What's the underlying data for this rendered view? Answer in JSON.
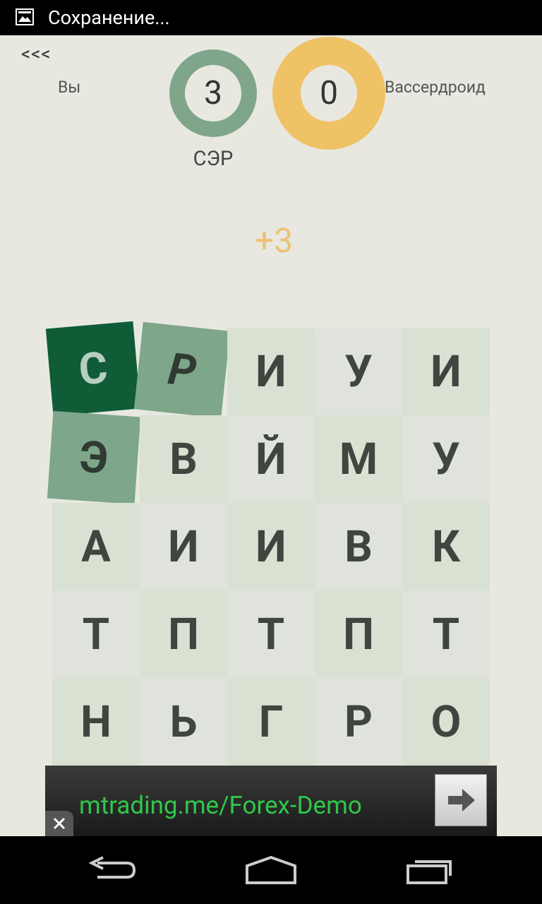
{
  "status": {
    "text": "Сохранение..."
  },
  "header": {
    "back_label": "<<<",
    "player_label": "Вы",
    "opponent_label": "Вассердроид",
    "player_score": "3",
    "opponent_score": "0",
    "current_word": "СЭР",
    "score_delta": "+3"
  },
  "grid": {
    "rows": [
      [
        "С",
        "Р",
        "И",
        "У",
        "И"
      ],
      [
        "Э",
        "В",
        "Й",
        "М",
        "У"
      ],
      [
        "А",
        "И",
        "И",
        "В",
        "К"
      ],
      [
        "Т",
        "П",
        "Т",
        "П",
        "Т"
      ],
      [
        "Н",
        "Ь",
        "Г",
        "Р",
        "О"
      ]
    ],
    "selected": [
      "r0c0",
      "r0c1",
      "r1c0"
    ]
  },
  "ad": {
    "text": "mtrading.me/Forex-Demo"
  },
  "colors": {
    "background": "#e8e8e1",
    "player_ring": "#7fa68a",
    "opponent_ring": "#f0c266",
    "selected_dark": "#0f5c37",
    "selected_mid": "#7ea68a",
    "tile_light": "#d8e1d2",
    "tile_grey": "#e0e2dc",
    "ad_text": "#2fc84a"
  },
  "icons": {
    "status": "image-icon",
    "ad_arrow": "arrow-right-icon",
    "ad_close": "close-icon",
    "nav_back": "back-icon",
    "nav_home": "home-icon",
    "nav_recents": "recents-icon"
  }
}
